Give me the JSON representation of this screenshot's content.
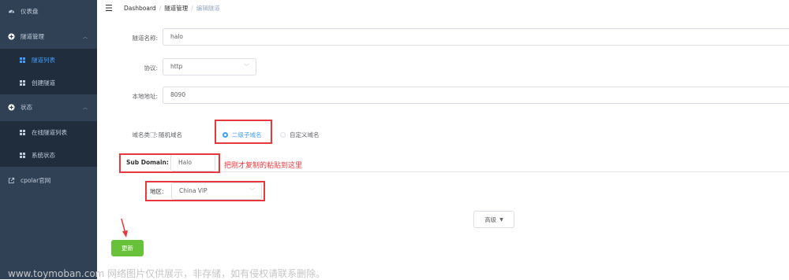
{
  "sidebar": {
    "items": [
      {
        "label": "仪表盘",
        "icon": "dashboard-icon"
      },
      {
        "label": "隧道管理",
        "icon": "plus-circle-icon"
      },
      {
        "label": "隧道列表",
        "icon": "grid-icon"
      },
      {
        "label": "创建隧道",
        "icon": "grid-icon"
      },
      {
        "label": "状态",
        "icon": "plus-circle-icon"
      },
      {
        "label": "在线隧道列表",
        "icon": "grid-icon"
      },
      {
        "label": "系统状态",
        "icon": "grid-icon"
      },
      {
        "label": "cpolar官网",
        "icon": "external-link-icon"
      }
    ]
  },
  "breadcrumb": {
    "home": "Dashboard",
    "section": "隧道管理",
    "current": "编辑隧道"
  },
  "form": {
    "tunnel_name_label": "隧道名称:",
    "tunnel_name_value": "halo",
    "protocol_label": "协议:",
    "protocol_value": "http",
    "local_address_label": "本地地址:",
    "local_address_value": "8090",
    "domain_type_label": "域名类型:",
    "domain_type_options": [
      "随机域名",
      "二级子域名",
      "自定义域名"
    ],
    "domain_type_selected": "二级子域名",
    "subdomain_label": "Sub Domain:",
    "subdomain_value": "Halo",
    "region_label": "地区:",
    "region_value": "China VIP",
    "advanced_label": "高级",
    "update_label": "更新"
  },
  "annotation": {
    "text": "把刚才复制的粘贴到这里",
    "color": "#e8383d"
  },
  "watermark": "www.toymoban.com 网络图片仅供展示，非存储，如有侵权请联系删除。",
  "colors": {
    "sidebar_bg": "#304156",
    "active": "#409eff",
    "update_button": "#67c23a",
    "highlight": "#e8383d"
  }
}
